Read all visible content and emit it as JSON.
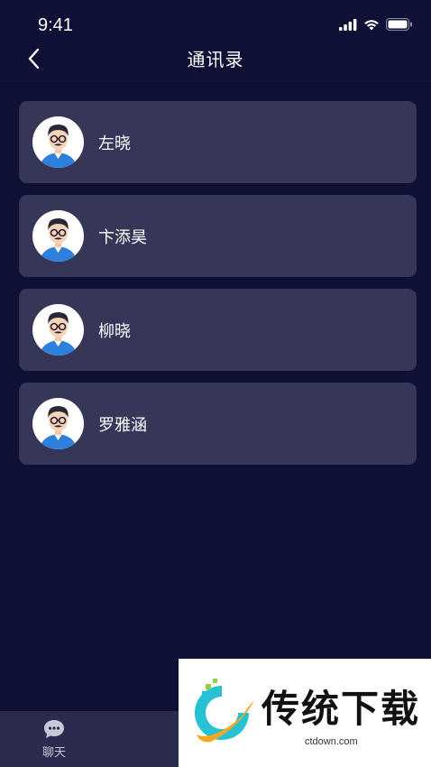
{
  "status_bar": {
    "time": "9:41"
  },
  "nav": {
    "title": "通讯录"
  },
  "contacts": [
    {
      "name": "左晓"
    },
    {
      "name": "卞添昊"
    },
    {
      "name": "柳晓"
    },
    {
      "name": "罗雅涵"
    }
  ],
  "tab_bar": {
    "items": [
      {
        "label": "聊天",
        "icon": "chat-bubble-icon"
      }
    ]
  },
  "watermark": {
    "text": "传统下载",
    "url": "ctdown.com"
  },
  "colors": {
    "background": "#0f1035",
    "card": "#353658",
    "tab_bar": "#2a2b4e"
  }
}
